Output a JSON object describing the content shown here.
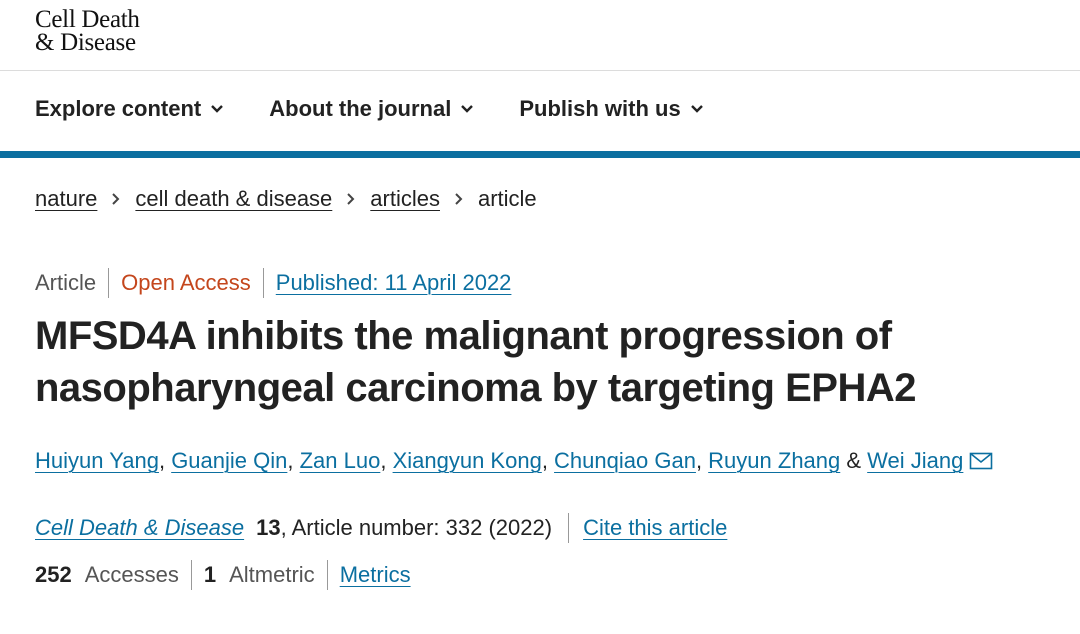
{
  "logo": {
    "line1": "Cell Death",
    "line2": "& Disease"
  },
  "nav": [
    {
      "label": "Explore content"
    },
    {
      "label": "About the journal"
    },
    {
      "label": "Publish with us"
    }
  ],
  "breadcrumb": [
    "nature",
    "cell death & disease",
    "articles",
    "article"
  ],
  "meta": {
    "type": "Article",
    "access": "Open Access",
    "published": "Published: 11 April 2022"
  },
  "title": "MFSD4A inhibits the malignant progression of nasopharyngeal carcinoma by targeting EPHA2",
  "authors": [
    "Huiyun Yang",
    "Guanjie Qin",
    "Zan Luo",
    "Xiangyun Kong",
    "Chunqiao Gan",
    "Ruyun Zhang",
    "Wei Jiang"
  ],
  "author_separators": {
    "comma": ", ",
    "and": " & "
  },
  "citation": {
    "journal": "Cell Death & Disease",
    "volume": "13",
    "details": ", Article number: 332 (2022)",
    "cite_label": "Cite this article"
  },
  "metrics": {
    "accesses_count": "252",
    "accesses_label": "Accesses",
    "altmetric_count": "1",
    "altmetric_label": "Altmetric",
    "metrics_link": "Metrics"
  },
  "colors": {
    "link": "#0b6fa0",
    "open_access": "#c4461c",
    "accent_bar": "#0b6fa0"
  },
  "icons": {
    "nav_chevron": "chevron-down-icon",
    "breadcrumb_separator": "chevron-right-icon",
    "corresponding_author": "envelope-icon"
  }
}
